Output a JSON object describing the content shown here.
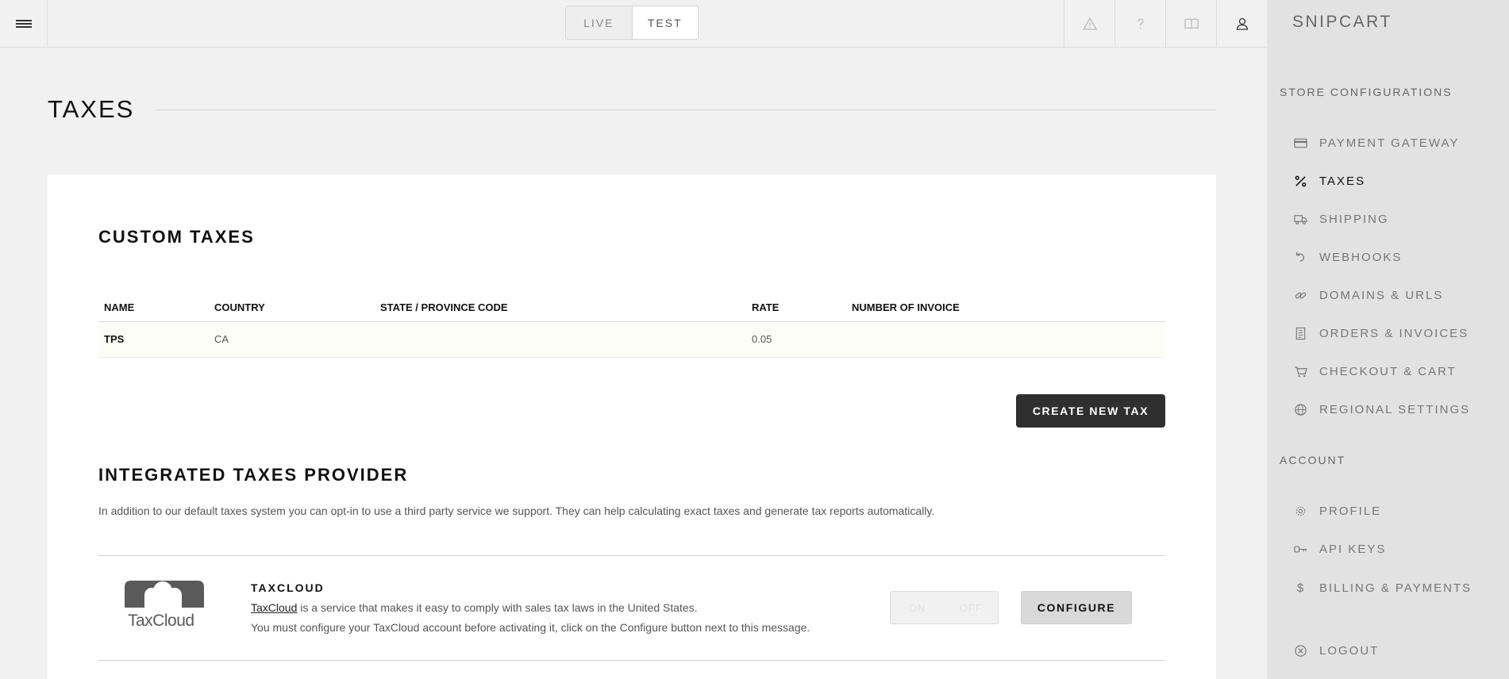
{
  "topbar": {
    "modes": [
      "LIVE",
      "TEST"
    ],
    "active_mode": "TEST",
    "icons": [
      "warning-icon",
      "help-icon",
      "docs-book-icon",
      "user-icon"
    ]
  },
  "page": {
    "title": "TAXES"
  },
  "custom_taxes": {
    "title": "CUSTOM TAXES",
    "columns": [
      "NAME",
      "COUNTRY",
      "STATE / PROVINCE CODE",
      "RATE",
      "NUMBER OF INVOICE"
    ],
    "rows": [
      {
        "name": "TPS",
        "country": "CA",
        "state": "",
        "rate": "0.05",
        "invoices": ""
      }
    ],
    "create_label": "CREATE NEW TAX"
  },
  "integrated": {
    "title": "INTEGRATED TAXES PROVIDER",
    "intro": "In addition to our default taxes system you can opt-in to use a third party service we support. They can help calculating exact taxes and generate tax reports automatically.",
    "provider": {
      "logo_text": "TaxCloud",
      "name": "TAXCLOUD",
      "link_text": "TaxCloud",
      "line1_rest": " is a service that makes it easy to comply with sales tax laws in the United States.",
      "line2": "You must configure your TaxCloud account before activating it, click on the Configure button next to this message.",
      "on_label": "ON",
      "off_label": "OFF",
      "configure_label": "CONFIGURE"
    }
  },
  "sidebar": {
    "brand": "SNIPCART",
    "store_heading": "STORE CONFIGURATIONS",
    "store_items": [
      {
        "label": "PAYMENT GATEWAY",
        "icon": "credit-card-icon"
      },
      {
        "label": "TAXES",
        "icon": "percent-icon",
        "active": true
      },
      {
        "label": "SHIPPING",
        "icon": "truck-icon"
      },
      {
        "label": "WEBHOOKS",
        "icon": "undo-arrow-icon"
      },
      {
        "label": "DOMAINS & URLS",
        "icon": "link-icon"
      },
      {
        "label": "ORDERS & INVOICES",
        "icon": "receipt-icon"
      },
      {
        "label": "CHECKOUT & CART",
        "icon": "cart-icon"
      },
      {
        "label": "REGIONAL SETTINGS",
        "icon": "globe-icon"
      }
    ],
    "account_heading": "ACCOUNT",
    "account_items": [
      {
        "label": "PROFILE",
        "icon": "gear-icon"
      },
      {
        "label": "API KEYS",
        "icon": "key-icon"
      },
      {
        "label": "BILLING & PAYMENTS",
        "icon": "dollar-icon"
      }
    ],
    "logout": {
      "label": "LOGOUT",
      "icon": "logout-icon"
    }
  }
}
